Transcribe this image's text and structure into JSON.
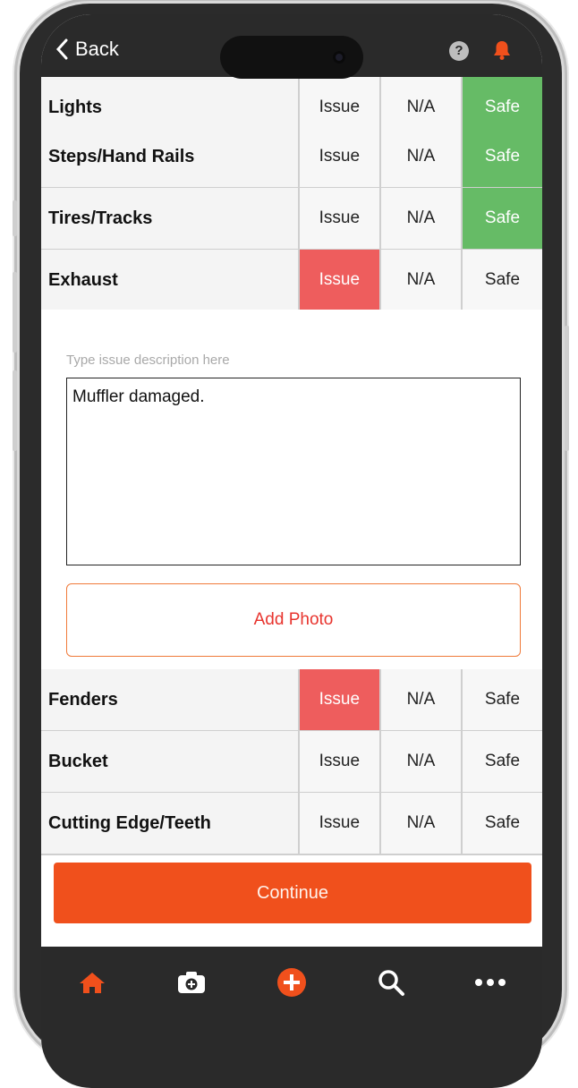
{
  "nav": {
    "back_label": "Back"
  },
  "checklist": [
    {
      "label": "Lights",
      "issue": "Issue",
      "na": "N/A",
      "safe": "Safe",
      "state": "safe"
    },
    {
      "label": "Steps/Hand Rails",
      "issue": "Issue",
      "na": "N/A",
      "safe": "Safe",
      "state": "safe"
    },
    {
      "label": "Tires/Tracks",
      "issue": "Issue",
      "na": "N/A",
      "safe": "Safe",
      "state": "safe"
    },
    {
      "label": "Exhaust",
      "issue": "Issue",
      "na": "N/A",
      "safe": "Safe",
      "state": "issue"
    },
    {
      "label": "Fenders",
      "issue": "Issue",
      "na": "N/A",
      "safe": "Safe",
      "state": "issue"
    },
    {
      "label": "Bucket",
      "issue": "Issue",
      "na": "N/A",
      "safe": "Safe",
      "state": "none"
    },
    {
      "label": "Cutting Edge/Teeth",
      "issue": "Issue",
      "na": "N/A",
      "safe": "Safe",
      "state": "none"
    }
  ],
  "issue_panel": {
    "hint": "Type issue description here",
    "description": "Muffler damaged.",
    "add_photo_label": "Add Photo"
  },
  "continue_label": "Continue",
  "tabs": [
    {
      "icon": "home-icon"
    },
    {
      "icon": "camera-add-icon"
    },
    {
      "icon": "plus-circle-icon"
    },
    {
      "icon": "search-icon"
    },
    {
      "icon": "more-icon"
    }
  ],
  "colors": {
    "accent": "#f0501c",
    "issue_active": "#ee5d5d",
    "safe_active": "#66bb66",
    "bar_dark": "#2a2a2a"
  }
}
